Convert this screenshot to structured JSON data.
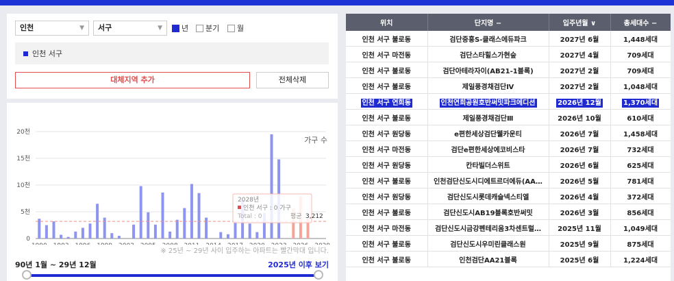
{
  "filters": {
    "region1": "인천",
    "region2": "서구",
    "period_options": [
      {
        "label": "년",
        "checked": true
      },
      {
        "label": "분기",
        "checked": false
      },
      {
        "label": "월",
        "checked": false
      }
    ]
  },
  "selected_region": "인천 서구",
  "buttons": {
    "add": "대체지역 추가",
    "clear": "전체삭제"
  },
  "chart_data": {
    "type": "bar",
    "legend": "가구 수",
    "y_ticks": [
      "0",
      "5천",
      "10천",
      "15천",
      "20천"
    ],
    "ylim": [
      0,
      20000
    ],
    "x_ticks": [
      "1990",
      "1993",
      "1996",
      "1999",
      "2002",
      "2005",
      "2008",
      "2011",
      "2014",
      "2017",
      "2020",
      "2023",
      "2026",
      "2029"
    ],
    "x": [
      1990,
      1991,
      1992,
      1993,
      1994,
      1995,
      1996,
      1997,
      1998,
      1999,
      2000,
      2001,
      2002,
      2003,
      2004,
      2005,
      2006,
      2007,
      2008,
      2009,
      2010,
      2011,
      2012,
      2013,
      2014,
      2015,
      2016,
      2017,
      2018,
      2019,
      2020,
      2021,
      2022,
      2023,
      2024,
      2025,
      2026,
      2027,
      2028,
      2029
    ],
    "values": [
      3700,
      2500,
      3200,
      700,
      300,
      1300,
      2000,
      2800,
      6500,
      3900,
      1000,
      500,
      0,
      2600,
      9800,
      4900,
      2600,
      8600,
      1300,
      3500,
      5700,
      10200,
      8500,
      3900,
      0,
      1200,
      800,
      3300,
      7200,
      2800,
      1200,
      4800,
      19500,
      14800,
      0,
      5600,
      7900,
      3700,
      0,
      0
    ],
    "avg_label": "평균",
    "avg_value": 3212,
    "avg_text": "3,212",
    "tooltip": {
      "title": "2028년",
      "line1": "인천 서구 : 0 가구",
      "line2": "Total : 0"
    },
    "highlight_colors": {
      "past": "#8d95ef",
      "future": "#f5a49b",
      "avg_line": "#f28b82"
    }
  },
  "note": "※ 25년 ~ 29년 사이 입주하는 아파트는 빨간막대 입니다.",
  "period_text": "90년 1월 ~ 29년 12월",
  "after_link": "2025년 이후 보기",
  "table": {
    "headers": [
      "위치",
      "단지명 −",
      "입주년월 ∨",
      "총세대수 −"
    ],
    "rows": [
      [
        "인천 서구 불로동",
        "검단중흥S-클래스에듀파크",
        "2027년 6월",
        "1,448세대"
      ],
      [
        "인천 서구 마전동",
        "검단스타힐스가현숲",
        "2027년 4월",
        "709세대"
      ],
      [
        "인천 서구 불로동",
        "검단아테라자이(AB21-1블록)",
        "2027년 2월",
        "709세대"
      ],
      [
        "인천 서구 불로동",
        "제일풍경채검단Ⅳ",
        "2027년 2월",
        "1,048세대"
      ],
      [
        "인천 서구 연희동",
        "인천연희공원호반써밋파크에디션",
        "2026년 12월",
        "1,370세대"
      ],
      [
        "인천 서구 불로동",
        "제일풍경채검단Ⅲ",
        "2026년 10월",
        "610세대"
      ],
      [
        "인천 서구 원당동",
        "e편한세상검단웰카운티",
        "2026년 7월",
        "1,458세대"
      ],
      [
        "인천 서구 마전동",
        "검단e편한세상에코비스타",
        "2026년 7월",
        "732세대"
      ],
      [
        "인천 서구 원당동",
        "칸타빌더스위트",
        "2026년 6월",
        "625세대"
      ],
      [
        "인천 서구 불로동",
        "인천검단신도시디에트르더에듀(AA…",
        "2026년 5월",
        "781세대"
      ],
      [
        "인천 서구 원당동",
        "검단신도시롯데캐슬넥스티엘",
        "2026년 4월",
        "372세대"
      ],
      [
        "인천 서구 불로동",
        "검단신도시AB19블록호반써밋",
        "2026년 3월",
        "856세대"
      ],
      [
        "인천 서구 마전동",
        "검단신도시금강펜테리움3차센트럴…",
        "2025년 11월",
        "1,049세대"
      ],
      [
        "인천 서구 불로동",
        "검단신도시우미린클래스원",
        "2025년 9월",
        "875세대"
      ],
      [
        "인천 서구 불로동",
        "인천검단AA21블록",
        "2025년 6월",
        "1,224세대"
      ]
    ],
    "highlighted_row": 4
  }
}
